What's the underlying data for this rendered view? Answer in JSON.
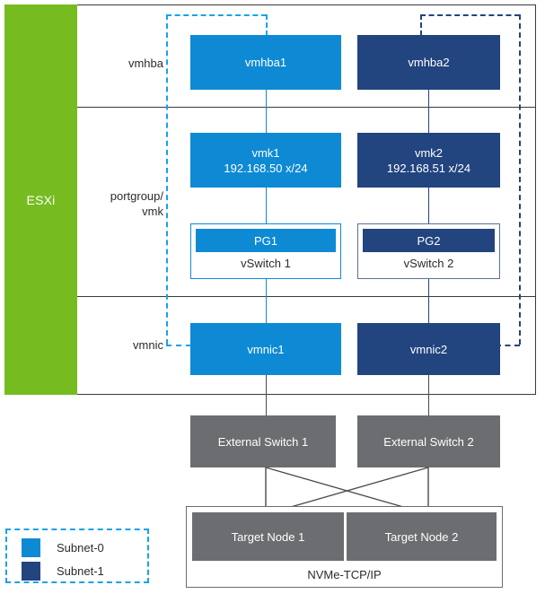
{
  "diagram": {
    "host": {
      "label": "ESXi"
    },
    "row_labels": [
      {
        "id": "vmhba",
        "text": "vmhba"
      },
      {
        "id": "portgroup-vmk",
        "line1": "portgroup/",
        "line2": "vmk"
      },
      {
        "id": "vmnic",
        "text": "vmnic"
      }
    ],
    "adapters": [
      {
        "id": "vmhba1",
        "label": "vmhba1",
        "subnet": "Subnet-0",
        "color": "#0e8ad4"
      },
      {
        "id": "vmhba2",
        "label": "vmhba2",
        "subnet": "Subnet-1",
        "color": "#22447f"
      }
    ],
    "vmkernels": [
      {
        "id": "vmk1",
        "name": "vmk1",
        "address": "192.168.50 x/24",
        "color": "#0e8ad4"
      },
      {
        "id": "vmk2",
        "name": "vmk2",
        "address": "192.168.51 x/24",
        "color": "#22447f"
      }
    ],
    "vswitches": [
      {
        "id": "vswitch1",
        "portgroup": "PG1",
        "name": "vSwitch 1",
        "color": "#0e8ad4",
        "border": "#0e8ad4"
      },
      {
        "id": "vswitch2",
        "portgroup": "PG2",
        "name": "vSwitch 2",
        "color": "#22447f",
        "border": "#5e6f9c"
      }
    ],
    "vmnics": [
      {
        "id": "vmnic1",
        "label": "vmnic1",
        "color": "#0e8ad4"
      },
      {
        "id": "vmnic2",
        "label": "vmnic2",
        "color": "#22447f"
      }
    ],
    "external_switches": [
      {
        "id": "external-switch-1",
        "label": "External Switch 1"
      },
      {
        "id": "external-switch-2",
        "label": "External Switch 2"
      }
    ],
    "target_nodes": [
      {
        "id": "target-node-1",
        "label": "Target Node 1"
      },
      {
        "id": "target-node-2",
        "label": "Target Node 2"
      }
    ],
    "target_enclosure": {
      "label": "NVMe-TCP/IP"
    },
    "legend": {
      "items": [
        {
          "id": "subnet-0",
          "label": "Subnet-0",
          "color": "#0e8ad4"
        },
        {
          "id": "subnet-1",
          "label": "Subnet-1",
          "color": "#22447f"
        }
      ]
    },
    "colors": {
      "host_green": "#76bc21",
      "subnet0_blue": "#0e8ad4",
      "subnet1_navy": "#22447f",
      "switch_gray": "#6b6d70",
      "frame_black": "#3a3a3a",
      "dash_blue": "#17a3e8"
    }
  }
}
